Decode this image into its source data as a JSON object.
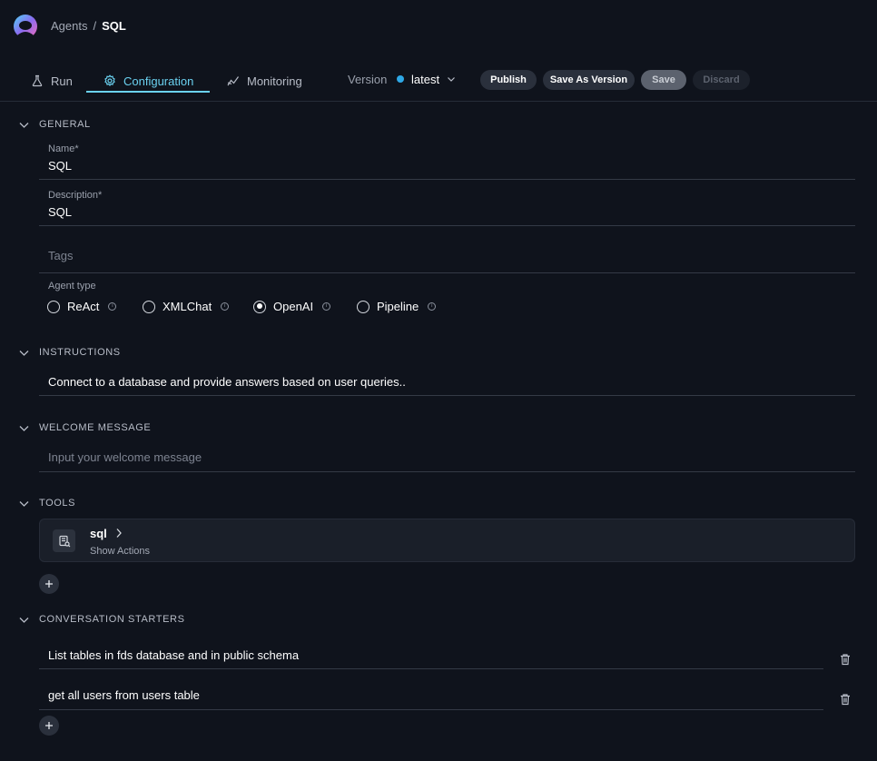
{
  "breadcrumb": {
    "parent": "Agents",
    "separator": "/",
    "current": "SQL"
  },
  "tabs": [
    {
      "label": "Run",
      "icon": "flask-icon",
      "active": false
    },
    {
      "label": "Configuration",
      "icon": "gear-icon",
      "active": true
    },
    {
      "label": "Monitoring",
      "icon": "chart-line-icon",
      "active": false
    }
  ],
  "version": {
    "label": "Version",
    "value": "latest"
  },
  "actions": {
    "publish": "Publish",
    "save_as_version": "Save As Version",
    "save": "Save",
    "discard": "Discard"
  },
  "general": {
    "title": "GENERAL",
    "name_label": "Name*",
    "name_value": "SQL",
    "description_label": "Description*",
    "description_value": "SQL",
    "tags_placeholder": "Tags",
    "agent_type_label": "Agent type",
    "agent_types": [
      {
        "label": "ReAct",
        "selected": false
      },
      {
        "label": "XMLChat",
        "selected": false
      },
      {
        "label": "OpenAI",
        "selected": true
      },
      {
        "label": "Pipeline",
        "selected": false
      }
    ]
  },
  "instructions": {
    "title": "INSTRUCTIONS",
    "value": "Connect to a database and provide answers based on user queries.."
  },
  "welcome": {
    "title": "WELCOME MESSAGE",
    "placeholder": "Input your welcome message"
  },
  "tools": {
    "title": "TOOLS",
    "items": [
      {
        "name": "sql",
        "sub": "Show Actions"
      }
    ]
  },
  "starters": {
    "title": "CONVERSATION STARTERS",
    "items": [
      "List tables in fds database and in public schema",
      "get all users from users table"
    ]
  },
  "colors": {
    "accent": "#6ad1f0",
    "background": "#0f131c",
    "version_dot": "#2ea8e6"
  }
}
